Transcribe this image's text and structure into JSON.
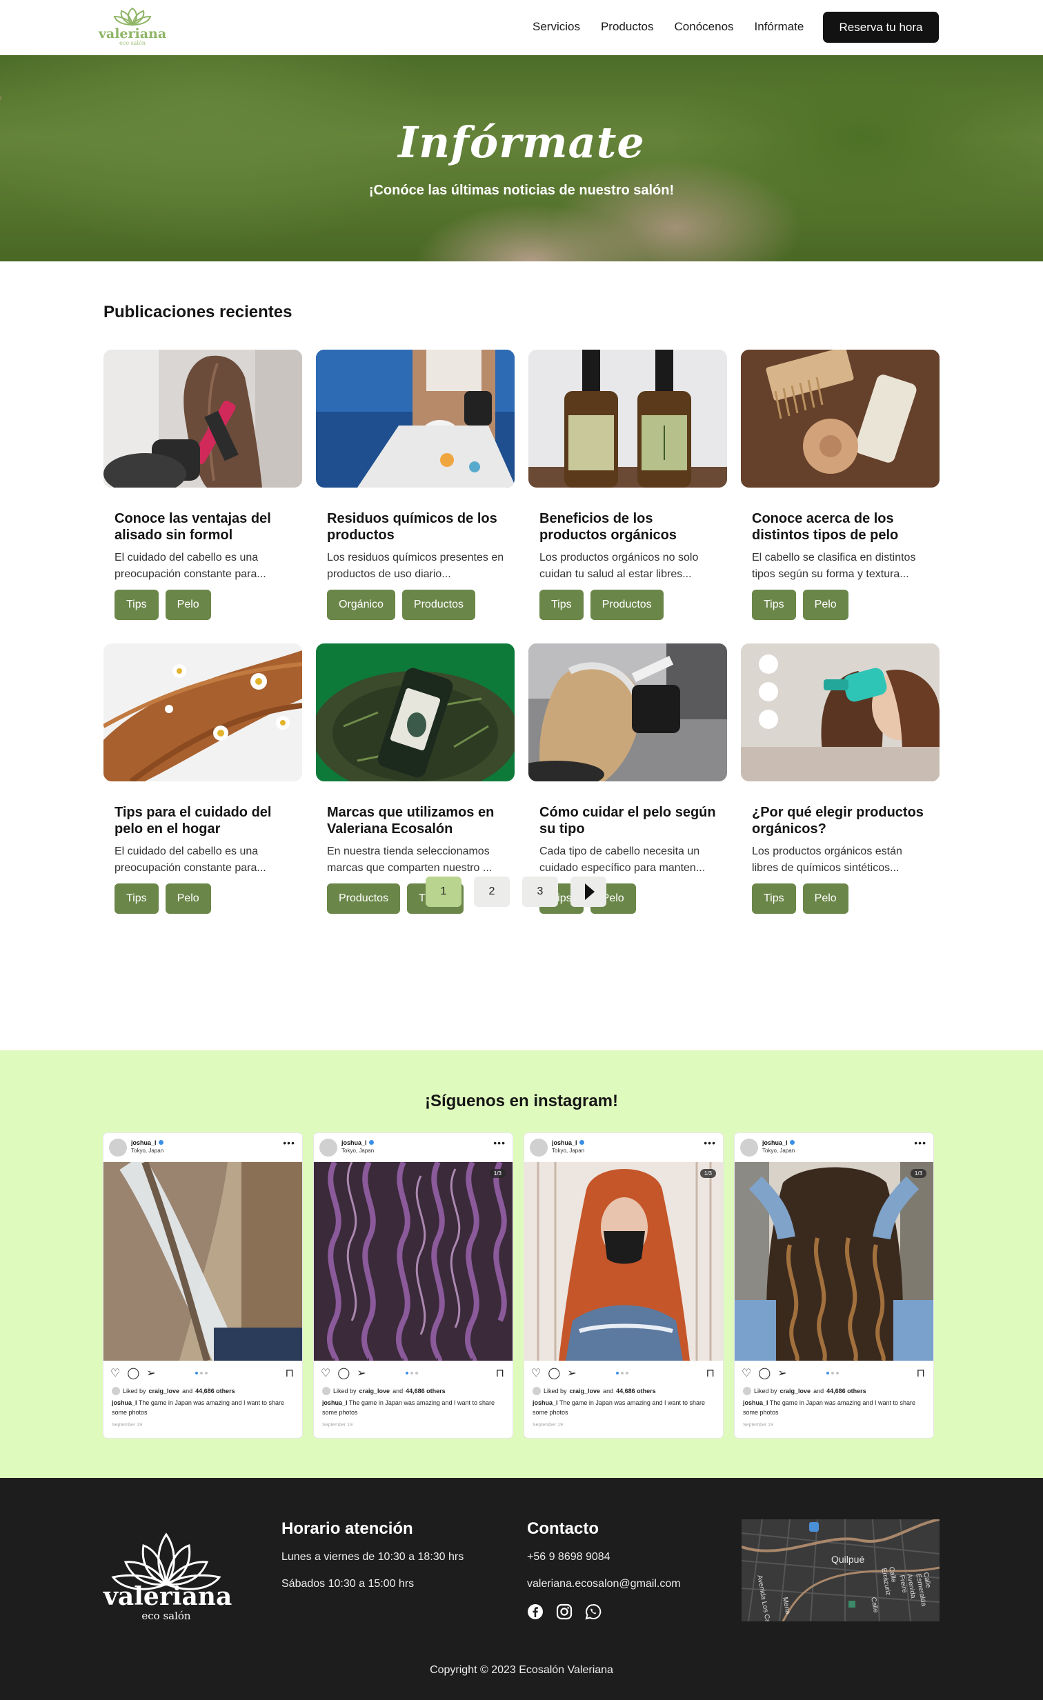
{
  "nav": {
    "logo_word": "valeriana",
    "logo_sub": "eco salón",
    "links": [
      "Servicios",
      "Productos",
      "Conócenos",
      "Infórmate"
    ],
    "cta": "Reserva tu hora"
  },
  "hero": {
    "title": "Infórmate",
    "subtitle": "¡Conóce las últimas noticias de nuestro salón!"
  },
  "posts": {
    "heading": "Publicaciones recientes",
    "items": [
      {
        "title": "Conoce las ventajas del alisado sin formol",
        "excerpt": "El cuidado del cabello es una preocupación constante para...",
        "tags": [
          "Tips",
          "Pelo"
        ]
      },
      {
        "title": "Residuos químicos de los productos",
        "excerpt": "Los residuos químicos presentes en productos de uso diario...",
        "tags": [
          "Orgánico",
          "Productos"
        ]
      },
      {
        "title": "Beneficios de los productos  orgánicos",
        "excerpt": "Los productos orgánicos no solo cuidan tu salud al estar libres...",
        "tags": [
          "Tips",
          "Productos"
        ]
      },
      {
        "title": "Conoce acerca de los distintos tipos de pelo",
        "excerpt": "El cabello se clasifica en distintos tipos según su forma y textura...",
        "tags": [
          "Tips",
          "Pelo"
        ]
      },
      {
        "title": "Tips para el cuidado del pelo en  el hogar",
        "excerpt": "El cuidado del cabello es una preocupación constante para...",
        "tags": [
          "Tips",
          "Pelo"
        ]
      },
      {
        "title": "Marcas que utilizamos en Valeriana Ecosalón",
        "excerpt": "En nuestra tienda seleccionamos marcas que comparten nuestro ...",
        "tags": [
          "Productos",
          "Tienda"
        ]
      },
      {
        "title": "Cómo cuidar el pelo según su tipo",
        "excerpt": "Cada tipo de cabello necesita un cuidado específico para manten...",
        "tags": [
          "Tips",
          "Pelo"
        ]
      },
      {
        "title": "¿Por qué elegir productos orgánicos?",
        "excerpt": "Los productos orgánicos están libres de químicos sintéticos...",
        "tags": [
          "Tips",
          "Pelo"
        ]
      }
    ]
  },
  "pagination": {
    "pages": [
      "1",
      "2",
      "3"
    ],
    "active": "1"
  },
  "instagram": {
    "heading": "¡Síguenos en instagram!",
    "posts": [
      {
        "user": "joshua_l",
        "location": "Tokyo, Japan",
        "liked_prefix": "Liked by",
        "liked_user": "craig_love",
        "liked_mid": "and",
        "liked_count": "44,686 others",
        "caption_user": "joshua_l",
        "caption": "The game in Japan was amazing and I want to share some photos",
        "date": "September 19",
        "counter": ""
      },
      {
        "user": "joshua_l",
        "location": "Tokyo, Japan",
        "liked_prefix": "Liked by",
        "liked_user": "craig_love",
        "liked_mid": "and",
        "liked_count": "44,686 others",
        "caption_user": "joshua_l",
        "caption": "The game in Japan was amazing and I want to share some photos",
        "date": "September 19",
        "counter": "1/3"
      },
      {
        "user": "joshua_l",
        "location": "Tokyo, Japan",
        "liked_prefix": "Liked by",
        "liked_user": "craig_love",
        "liked_mid": "and",
        "liked_count": "44,686 others",
        "caption_user": "joshua_l",
        "caption": "The game in Japan was amazing and I want to share some photos",
        "date": "September 19",
        "counter": "1/3"
      },
      {
        "user": "joshua_l",
        "location": "Tokyo, Japan",
        "liked_prefix": "Liked by",
        "liked_user": "craig_love",
        "liked_mid": "and",
        "liked_count": "44,686 others",
        "caption_user": "joshua_l",
        "caption": "The game in Japan was amazing and I want to share some photos",
        "date": "September 19",
        "counter": "1/3"
      }
    ]
  },
  "footer": {
    "logo_word": "valeriana",
    "logo_sub": "eco salón",
    "hours_heading": "Horario atención",
    "hours_lines": [
      "Lunes a viernes de 10:30 a 18:30 hrs",
      "Sábados 10:30 a 15:00 hrs"
    ],
    "contact_heading": "Contacto",
    "phone": "+56 9 8698 9084",
    "email": "valeriana.ecosalon@gmail.com",
    "socials": [
      "facebook-icon",
      "instagram-icon",
      "whatsapp-icon"
    ],
    "map_label": "Quilpué",
    "map_streets": [
      "Mena",
      "Calle",
      "Calle Errázuriz",
      "Avenida Los Carrera",
      "Avenida Freire",
      "Calle Esmeralda"
    ],
    "copyright": "Copyright © 2023 Ecosalón Valeriana"
  },
  "colors": {
    "accent_green": "#6b8649",
    "light_green": "#dffabd",
    "pager_active": "#b9d48f",
    "footer_bg": "#1d1d1d"
  }
}
